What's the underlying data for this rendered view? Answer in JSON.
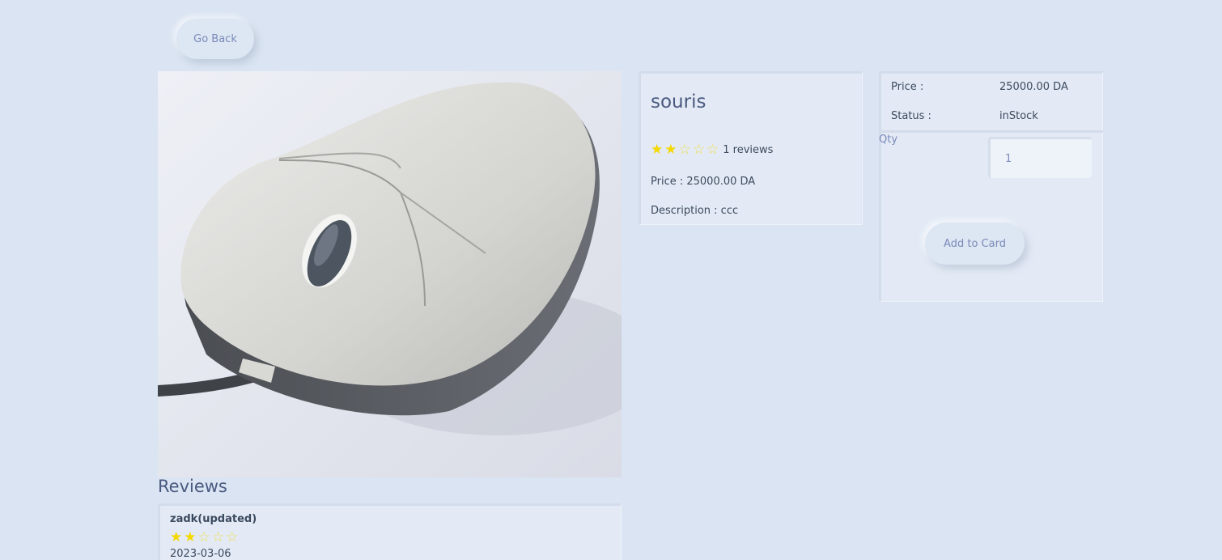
{
  "nav": {
    "back_label": "Go Back"
  },
  "product": {
    "image_alt": "souris",
    "name": "souris",
    "rating": 2,
    "max_rating": 5,
    "reviews_text": "1 reviews",
    "price_text": "Price : 25000.00 DA",
    "description_text": "Description : ccc"
  },
  "purchase": {
    "price_label": "Price :",
    "price_value": "25000.00 DA",
    "status_label": "Status :",
    "status_value": "inStock",
    "qty_label": "Qty",
    "qty_value": "1",
    "add_label": "Add to Card"
  },
  "reviews": {
    "title": "Reviews",
    "items": [
      {
        "author": "zadk(updated)",
        "rating": 2,
        "date": "2023-03-06"
      }
    ]
  },
  "colors": {
    "background": "#dae4f2",
    "card": "#e3eaf5",
    "accent_text": "#7a8bb8",
    "star": "#f5d800"
  },
  "icons": {
    "star_full": "star-icon",
    "star_empty": "star-outline-icon"
  }
}
